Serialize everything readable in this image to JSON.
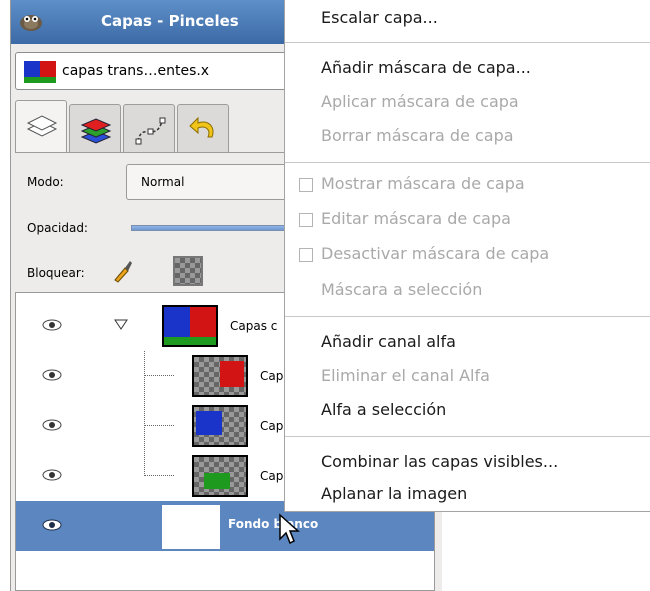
{
  "window": {
    "title": "Capas - Pinceles"
  },
  "image_selector": {
    "label": "capas trans…entes.x"
  },
  "tabs": [
    {
      "name": "layers",
      "active": true
    },
    {
      "name": "channels",
      "active": false
    },
    {
      "name": "paths",
      "active": false
    },
    {
      "name": "undo",
      "active": false
    }
  ],
  "mode": {
    "label": "Modo:",
    "value": "Normal"
  },
  "opacity": {
    "label": "Opacidad:"
  },
  "lock": {
    "label": "Bloquear:"
  },
  "layers": [
    {
      "name": "Capas c",
      "visible": true,
      "selected": false
    },
    {
      "name": "Cap",
      "visible": true,
      "selected": false
    },
    {
      "name": "Cap",
      "visible": true,
      "selected": false
    },
    {
      "name": "Cap",
      "visible": true,
      "selected": false
    },
    {
      "name": "Fondo blanco",
      "visible": true,
      "selected": true
    }
  ],
  "context_menu": {
    "items": [
      {
        "label": "Escalar capa...",
        "enabled": true
      },
      {
        "label": "Añadir máscara de capa...",
        "enabled": true
      },
      {
        "label": "Aplicar máscara de capa",
        "enabled": false
      },
      {
        "label": "Borrar máscara de capa",
        "enabled": false
      },
      {
        "label": "Mostrar máscara de capa",
        "enabled": false,
        "checkbox": true
      },
      {
        "label": "Editar máscara de capa",
        "enabled": false,
        "checkbox": true
      },
      {
        "label": "Desactivar máscara de capa",
        "enabled": false,
        "checkbox": true
      },
      {
        "label": "Máscara a selección",
        "enabled": false
      },
      {
        "label": "Añadir canal alfa",
        "enabled": true
      },
      {
        "label": "Eliminar el canal Alfa",
        "enabled": false
      },
      {
        "label": "Alfa a selección",
        "enabled": true
      },
      {
        "label": "Combinar las capas visibles...",
        "enabled": true
      },
      {
        "label": "Aplanar la imagen",
        "enabled": true
      }
    ]
  },
  "colors": {
    "titlebar": "#3b6aa6",
    "selection": "#5b86c0",
    "disabled_text": "#a9a9a9"
  }
}
